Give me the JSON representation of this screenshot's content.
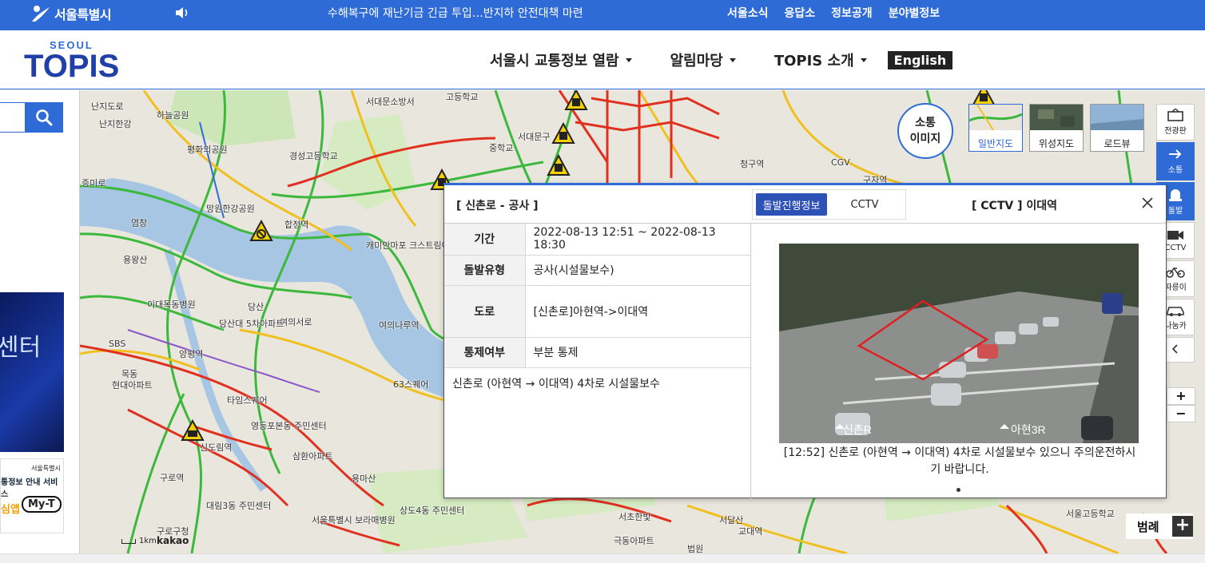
{
  "topbar": {
    "city_name": "서울특별시",
    "news": "수해복구에 재난기금 긴급 투입…반지하 안전대책 마련",
    "links": [
      "서울소식",
      "응답소",
      "정보공개",
      "분야별정보"
    ]
  },
  "header": {
    "logo_small": "SEOUL",
    "logo_big": "TOPIS",
    "nav": [
      "서울시 교통정보 열람",
      "알림마당",
      "TOPIS 소개"
    ],
    "english": "English"
  },
  "left_panel": {
    "banner1_text": "센터",
    "banner2": {
      "brand": "서울특별시",
      "line": "통정보 안내 서비스",
      "app": "심앱",
      "badge": "My-T"
    }
  },
  "map": {
    "traffic_image_button": [
      "소통",
      "이미지"
    ],
    "map_types": [
      {
        "label": "일반지도",
        "active": true
      },
      {
        "label": "위성지도",
        "active": false
      },
      {
        "label": "로드뷰",
        "active": false
      }
    ],
    "toolbar": [
      {
        "label": "전광판",
        "icon": "billboard-icon",
        "active": false
      },
      {
        "label": "소통",
        "icon": "arrow-right-icon",
        "active": true
      },
      {
        "label": "돌발",
        "icon": "siren-icon",
        "active": true
      },
      {
        "label": "CCTV",
        "icon": "camera-icon",
        "active": false
      },
      {
        "label": "따릉이",
        "icon": "bicycle-icon",
        "active": false
      },
      {
        "label": "나눔카",
        "icon": "car-icon",
        "active": false
      }
    ],
    "zoom_in": "+",
    "zoom_out": "−",
    "legend": "범례",
    "legend_toggle": "+",
    "scale": "1km",
    "provider": "kakao",
    "labels": [
      "난지도로",
      "하늘공원",
      "서대문소방서",
      "고등학교",
      "난지한강",
      "경성고등학교",
      "평화의공원",
      "증미로",
      "망원한강공원",
      "합정역",
      "염창",
      "용왕산",
      "이대목동병원",
      "당산",
      "여의서로",
      "당산대 5차아파트",
      "목동",
      "현대아파트",
      "SBS",
      "영등포본동 주민센터",
      "신도림역",
      "구로역",
      "대림3동 주민센터",
      "구로구청",
      "서울특별시 보라매병원",
      "삼환아파트",
      "용마산",
      "상도4동 주민센터",
      "서초한빛",
      "서울고등학교",
      "교대역",
      "청구역",
      "구자역",
      "CGV",
      "타임스퀘어",
      "63스퀘어",
      "캐미안마포 크스트림아파트",
      "서대문구",
      "중학교",
      "양평역",
      "여의나루역",
      "서달산",
      "극동아파트",
      "법원",
      "1km"
    ]
  },
  "popup": {
    "title": "[ 신촌로 - 공사 ]",
    "tabs": [
      "돌발진행정보",
      "CCTV"
    ],
    "cctv_title": "[ CCTV ] 이대역",
    "rows": [
      {
        "label": "기간",
        "value": "2022-08-13 12:51 ~ 2022-08-13 18:30"
      },
      {
        "label": "돌발유형",
        "value": "공사(시설물보수)"
      },
      {
        "label": "도로",
        "value": "[신촌로]아현역->이대역"
      },
      {
        "label": "통제여부",
        "value": "부분 통제"
      }
    ],
    "description": "신촌로 (아현역 → 이대역) 4차로 시설물보수",
    "cam_overlay": [
      "신촌R",
      "아현3R"
    ],
    "caption": "[12:52] 신촌로 (아현역 → 이대역) 4차로 시설물보수 있으니 주의운전하시기 바랍니다."
  },
  "colors": {
    "brand_blue": "#2e6bd6",
    "road_green": "#3cb83c",
    "road_yellow": "#f0c020",
    "road_red": "#e03020"
  }
}
